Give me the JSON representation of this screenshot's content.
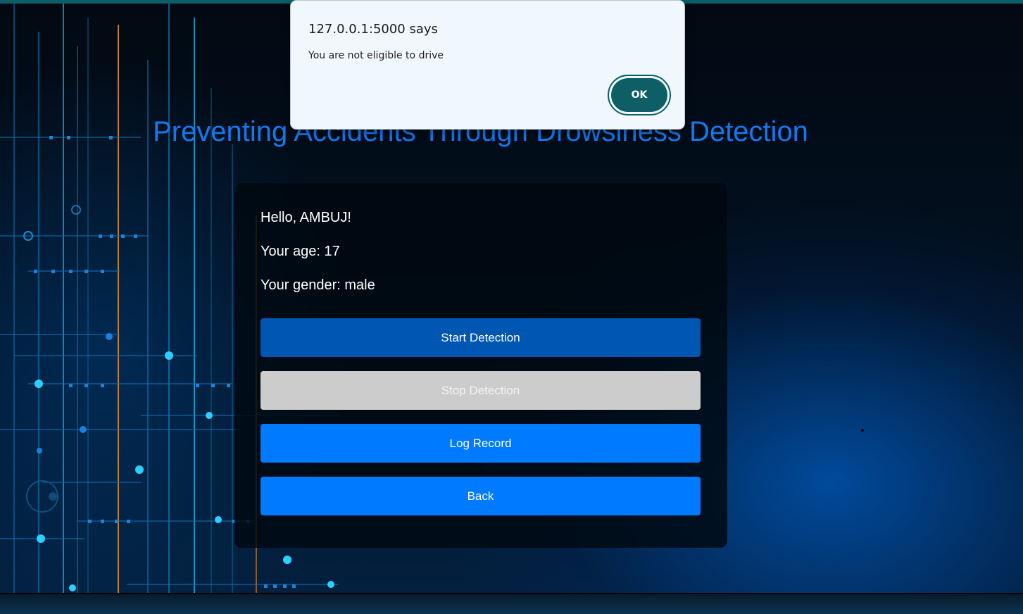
{
  "dialog": {
    "title": "127.0.0.1:5000 says",
    "message": "You are not eligible to drive",
    "ok_label": "OK"
  },
  "page": {
    "title": "Preventing Accidents Through Drowsiness Detection"
  },
  "user": {
    "greeting": "Hello, AMBUJ!",
    "age_line": "Your age: 17",
    "gender_line": "Your gender: male"
  },
  "buttons": {
    "start": "Start Detection",
    "stop": "Stop Detection",
    "log": "Log Record",
    "back": "Back"
  },
  "colors": {
    "title": "#1479ef",
    "start_button": "#0056b3",
    "stop_button_disabled": "#cccccc",
    "primary_button": "#007bff",
    "dialog_ok": "#0e5e66"
  }
}
